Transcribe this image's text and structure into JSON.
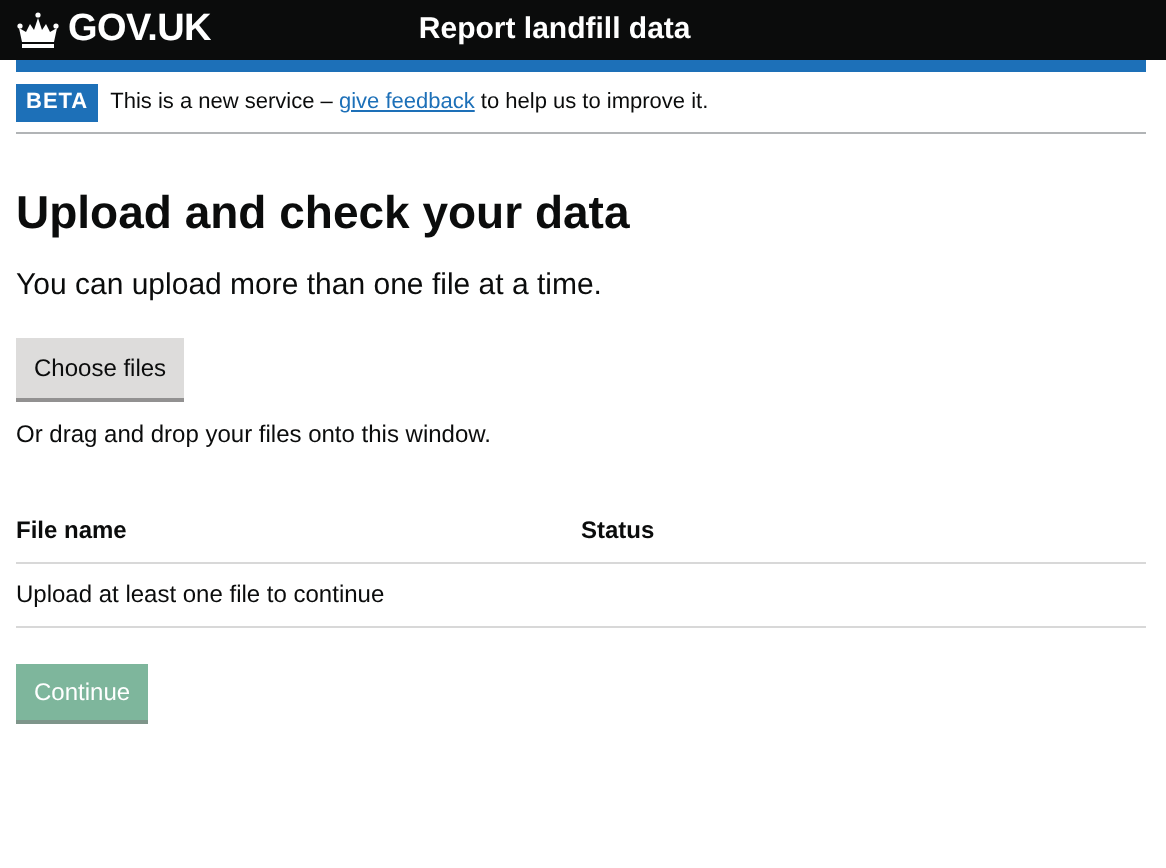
{
  "header": {
    "logo": "GOV.UK",
    "service_name": "Report landfill data"
  },
  "phase_banner": {
    "tag": "BETA",
    "text_before": "This is a new service – ",
    "link": "give feedback",
    "text_after": " to help us to improve it."
  },
  "heading": "Upload and check your data",
  "lead": "You can upload more than one file at a time.",
  "choose_button": "Choose files",
  "hint": "Or drag and drop your files onto this window.",
  "table": {
    "columns": [
      "File name",
      "Status"
    ],
    "empty_message": "Upload at least one file to continue"
  },
  "continue_button": {
    "label": "Continue",
    "disabled": true
  }
}
